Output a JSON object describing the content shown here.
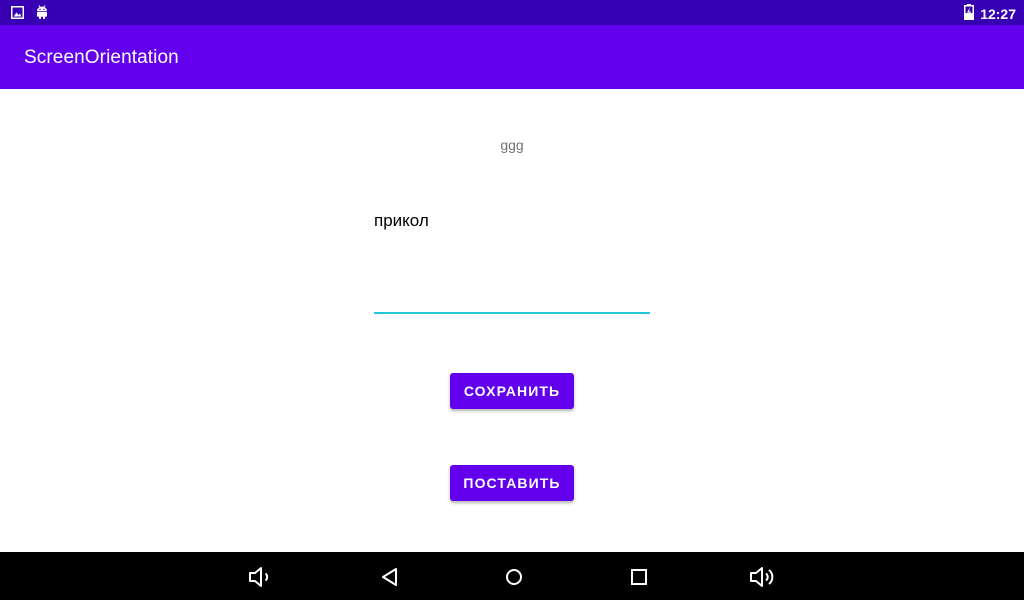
{
  "status_bar": {
    "time": "12:27",
    "icons": [
      "image-icon",
      "android-icon",
      "battery-charging-icon"
    ]
  },
  "app_bar": {
    "title": "ScreenOrientation"
  },
  "main": {
    "label_text": "ggg",
    "edit_text_value": "прикол",
    "save_button_label": "СОХРАНИТЬ",
    "put_button_label": "ПОСТАВИТЬ"
  },
  "nav_bar": {
    "icons": [
      "volume-down-icon",
      "back-icon",
      "home-icon",
      "recents-icon",
      "volume-up-icon"
    ]
  },
  "colors": {
    "status_bar": "#3700b3",
    "app_bar": "#6200ee",
    "button": "#6200ee",
    "edit_underline": "#26c6da",
    "nav_bar": "#000000"
  }
}
